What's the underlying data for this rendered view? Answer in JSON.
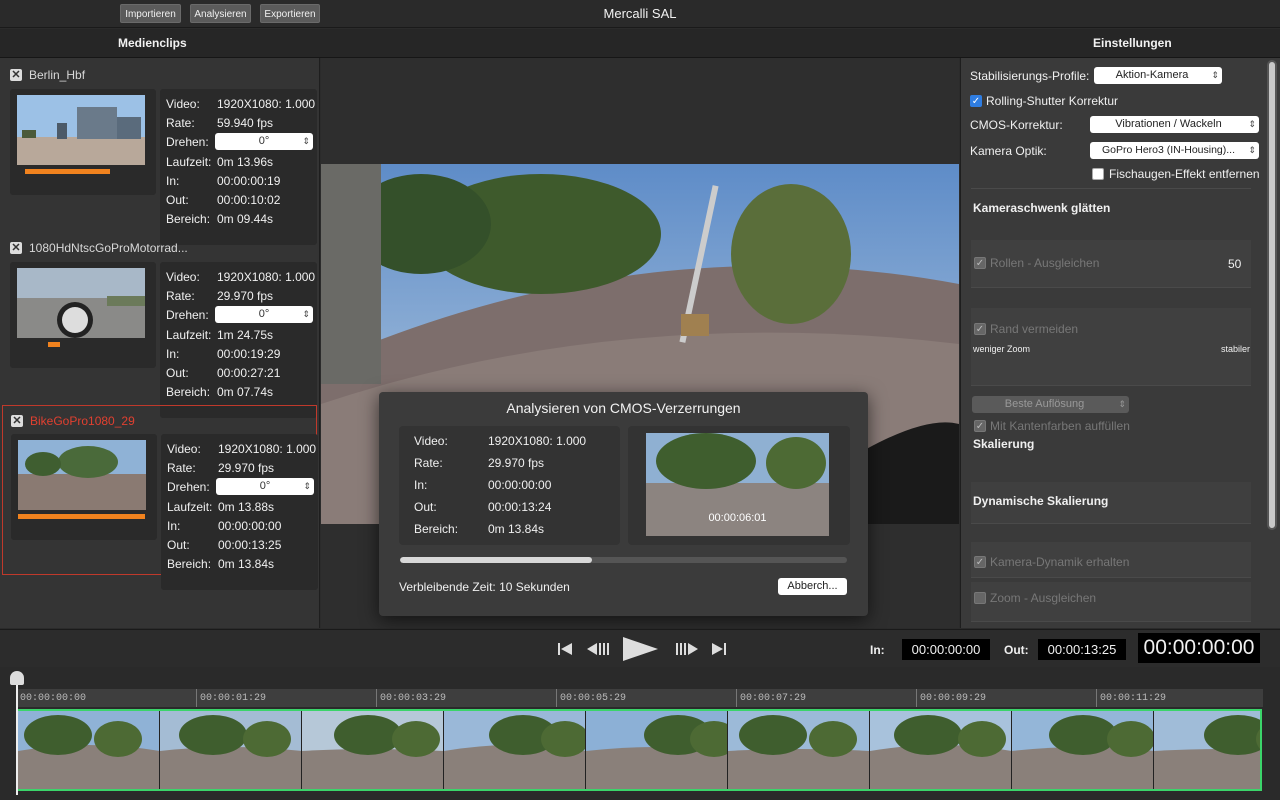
{
  "app": {
    "title": "Mercalli SAL"
  },
  "toolbar": {
    "import": "Importieren",
    "analyze": "Analysieren",
    "export": "Exportieren"
  },
  "headers": {
    "left": "Medienclips",
    "right": "Einstellungen"
  },
  "clips": [
    {
      "name": "Berlin_Hbf",
      "video_label": "Video:",
      "video": "1920X1080: 1.000",
      "rate_label": "Rate:",
      "rate": "59.940 fps",
      "rotate_label": "Drehen:",
      "rotate": "0°",
      "duration_label": "Laufzeit:",
      "duration": "0m 13.96s",
      "in_label": "In:",
      "in": "00:00:00:19",
      "out_label": "Out:",
      "out": "00:00:10:02",
      "range_label": "Bereich:",
      "range": "0m 09.44s"
    },
    {
      "name": "1080HdNtscGoProMotorrad...",
      "video_label": "Video:",
      "video": "1920X1080: 1.000",
      "rate_label": "Rate:",
      "rate": "29.970 fps",
      "rotate_label": "Drehen:",
      "rotate": "0°",
      "duration_label": "Laufzeit:",
      "duration": "1m 24.75s",
      "in_label": "In:",
      "in": "00:00:19:29",
      "out_label": "Out:",
      "out": "00:00:27:21",
      "range_label": "Bereich:",
      "range": "0m 07.74s"
    },
    {
      "name": "BikeGoPro1080_29",
      "video_label": "Video:",
      "video": "1920X1080: 1.000",
      "rate_label": "Rate:",
      "rate": "29.970 fps",
      "rotate_label": "Drehen:",
      "rotate": "0°",
      "duration_label": "Laufzeit:",
      "duration": "0m 13.88s",
      "in_label": "In:",
      "in": "00:00:00:00",
      "out_label": "Out:",
      "out": "00:00:13:25",
      "range_label": "Bereich:",
      "range": "0m 13.84s"
    }
  ],
  "dialog": {
    "title": "Analysieren von CMOS-Verzerrungen",
    "video_label": "Video:",
    "video": "1920X1080: 1.000",
    "rate_label": "Rate:",
    "rate": "29.970 fps",
    "in_label": "In:",
    "in": "00:00:00:00",
    "out_label": "Out:",
    "out": "00:00:13:24",
    "range_label": "Bereich:",
    "range": "0m 13.84s",
    "thumb_time": "00:00:06:01",
    "progress": 0.43,
    "remaining": "Verbleibende Zeit: 10 Sekunden",
    "cancel": "Abberch..."
  },
  "settings": {
    "profile_label": "Stabilisierungs-Profile:",
    "profile": "Aktion-Kamera",
    "rolling_shutter": "Rolling-Shutter Korrektur",
    "cmos_label": "CMOS-Korrektur:",
    "cmos": "Vibrationen / Wackeln",
    "optics_label": "Kamera Optik:",
    "optics": "GoPro Hero3 (IN-Housing)...",
    "fisheye": "Fischaugen-Effekt entfernen",
    "pan_title": "Kameraschwenk glätten",
    "roll": "Rollen - Ausgleichen",
    "roll_value": "50",
    "border": "Rand vermeiden",
    "less_zoom": "weniger Zoom",
    "stable": "stabiler",
    "resolution": "Beste Auflösung",
    "edge_fill": "Mit Kantenfarben auffüllen",
    "scaling": "Skalierung",
    "dyn_scaling": "Dynamische Skalierung",
    "cam_dynamics": "Kamera-Dynamik erhalten",
    "zoom": "Zoom - Ausgleichen"
  },
  "transport": {
    "in_label": "In:",
    "in": "00:00:00:00",
    "out_label": "Out:",
    "out": "00:00:13:25",
    "current": "00:00:00:00"
  },
  "timeline": {
    "ticks": [
      "00:00:00:00",
      "00:00:01:29",
      "00:00:03:29",
      "00:00:05:29",
      "00:00:07:29",
      "00:00:09:29",
      "00:00:11:29"
    ]
  },
  "colors": {
    "accent": "#f0821e",
    "selection": "#c0392b",
    "strip_border": "#3bd46a",
    "checkbox": "#2f7de1"
  }
}
